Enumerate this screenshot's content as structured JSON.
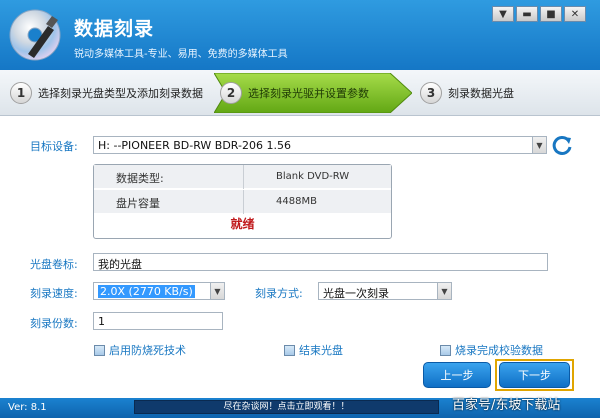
{
  "app": {
    "title": "数据刻录",
    "subtitle": "锐动多媒体工具-专业、易用、免费的多媒体工具",
    "window_buttons": [
      "menu-icon",
      "minimize-icon",
      "maximize-icon",
      "close-icon"
    ]
  },
  "steps": [
    {
      "num": "1",
      "label": "选择刻录光盘类型及添加刻录数据"
    },
    {
      "num": "2",
      "label": "选择刻录光驱并设置参数"
    },
    {
      "num": "3",
      "label": "刻录数据光盘"
    }
  ],
  "form": {
    "target_device_label": "目标设备:",
    "target_device_value": "H:  --PIONEER BD-RW   BDR-206  1.56",
    "disc_info": {
      "type_label": "数据类型:",
      "type_value": "Blank DVD-RW",
      "capacity_label": "盘片容量",
      "capacity_value": "4488MB",
      "status": "就绪"
    },
    "volume_label": "光盘卷标:",
    "volume_value": "我的光盘",
    "speed_label": "刻录速度:",
    "speed_value": "2.0X  (2770 KB/s)",
    "mode_label": "刻录方式:",
    "mode_value": "光盘一次刻录",
    "copies_label": "刻录份数:",
    "copies_value": "1",
    "checkboxes": [
      {
        "label": "启用防烧死技术"
      },
      {
        "label": "结束光盘"
      },
      {
        "label": "烧录完成校验数据"
      }
    ],
    "prev_button": "上一步",
    "next_button": "下一步"
  },
  "status": {
    "version": "Ver: 8.1",
    "marquee": "尽在杂谈网！点击立即观看！！",
    "watermark": "百家号/东坡下载站"
  },
  "colors": {
    "title_bar": "#1a80cc",
    "active_step": "#72b51a",
    "label_blue": "#1877c2",
    "status_red": "#c0181b"
  }
}
